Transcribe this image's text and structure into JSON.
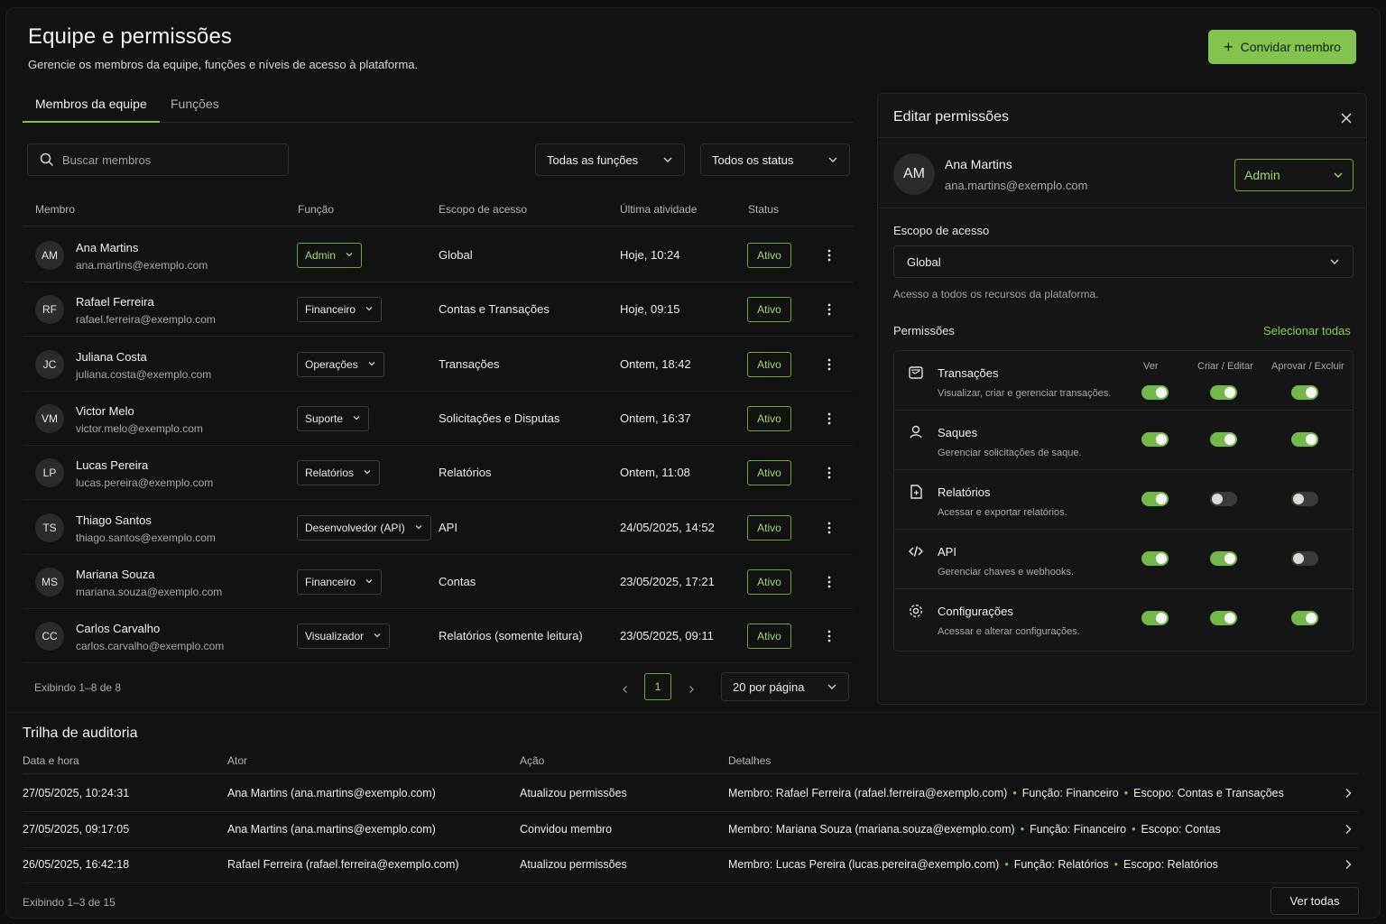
{
  "header": {
    "title": "Equipe e permissões",
    "subtitle": "Gerencie os membros da equipe, funções e níveis de acesso à plataforma.",
    "invite_label": "Convidar membro"
  },
  "tabs": [
    {
      "label": "Membros da equipe",
      "active": true
    },
    {
      "label": "Funções",
      "active": false
    }
  ],
  "filters": {
    "search_placeholder": "Buscar membros",
    "role_filter": "Todas as funções",
    "status_filter": "Todos os status"
  },
  "table": {
    "columns": [
      "Membro",
      "Função",
      "Escopo de acesso",
      "Última atividade",
      "Status"
    ],
    "rows": [
      {
        "initials": "AM",
        "name": "Ana Martins",
        "email": "ana.martins@exemplo.com",
        "role": "Admin",
        "scope": "Global",
        "last": "Hoje, 10:24",
        "status": "Ativo"
      },
      {
        "initials": "RF",
        "name": "Rafael Ferreira",
        "email": "rafael.ferreira@exemplo.com",
        "role": "Financeiro",
        "scope": "Contas e Transações",
        "last": "Hoje, 09:15",
        "status": "Ativo"
      },
      {
        "initials": "JC",
        "name": "Juliana Costa",
        "email": "juliana.costa@exemplo.com",
        "role": "Operações",
        "scope": "Transações",
        "last": "Ontem, 18:42",
        "status": "Ativo"
      },
      {
        "initials": "VM",
        "name": "Victor Melo",
        "email": "victor.melo@exemplo.com",
        "role": "Suporte",
        "scope": "Solicitações e Disputas",
        "last": "Ontem, 16:37",
        "status": "Ativo"
      },
      {
        "initials": "LP",
        "name": "Lucas Pereira",
        "email": "lucas.pereira@exemplo.com",
        "role": "Relatórios",
        "scope": "Relatórios",
        "last": "Ontem, 11:08",
        "status": "Ativo"
      },
      {
        "initials": "TS",
        "name": "Thiago Santos",
        "email": "thiago.santos@exemplo.com",
        "role": "Desenvolvedor (API)",
        "scope": "API",
        "last": "24/05/2025, 14:52",
        "status": "Ativo"
      },
      {
        "initials": "MS",
        "name": "Mariana Souza",
        "email": "mariana.souza@exemplo.com",
        "role": "Financeiro",
        "scope": "Contas",
        "last": "23/05/2025, 17:21",
        "status": "Ativo"
      },
      {
        "initials": "CC",
        "name": "Carlos Carvalho",
        "email": "carlos.carvalho@exemplo.com",
        "role": "Visualizador",
        "scope": "Relatórios (somente leitura)",
        "last": "23/05/2025, 09:11",
        "status": "Ativo"
      }
    ],
    "showing": "Exibindo 1–8 de 8",
    "page": "1",
    "per_page": "20 por página"
  },
  "panel": {
    "title": "Editar permissões",
    "member_initials": "AM",
    "member_name": "Ana Martins",
    "member_email": "ana.martins@exemplo.com",
    "member_role": "Admin",
    "scope_label": "Escopo de acesso",
    "scope_value": "Global",
    "scope_hint": "Acesso a todos os recursos da plataforma.",
    "permissions_label": "Permissões",
    "select_all": "Selecionar todas",
    "columns": [
      "Ver",
      "Criar / Editar",
      "Aprovar / Excluir"
    ],
    "permissions": [
      {
        "name": "Transações",
        "desc": "Visualizar, criar e gerenciar transações.",
        "icon": "transactions-icon",
        "view": true,
        "edit": true,
        "approve": true
      },
      {
        "name": "Saques",
        "desc": "Gerenciar solicitações de saque.",
        "icon": "withdraw-icon",
        "view": true,
        "edit": true,
        "approve": true
      },
      {
        "name": "Relatórios",
        "desc": "Acessar e exportar relatórios.",
        "icon": "report-icon",
        "view": true,
        "edit": false,
        "approve": false
      },
      {
        "name": "API",
        "desc": "Gerenciar chaves e webhooks.",
        "icon": "code-icon",
        "view": true,
        "edit": true,
        "approve": false
      },
      {
        "name": "Configurações",
        "desc": "Acessar e alterar configurações.",
        "icon": "gear-icon",
        "view": true,
        "edit": true,
        "approve": true
      }
    ]
  },
  "audit": {
    "title": "Trilha de auditoria",
    "columns": [
      "Data e hora",
      "Ator",
      "Ação",
      "Detalhes"
    ],
    "rows": [
      {
        "when": "27/05/2025, 10:24:31",
        "actor": "Ana Martins (ana.martins@exemplo.com)",
        "action": "Atualizou permissões",
        "d1": "Membro: Rafael Ferreira (rafael.ferreira@exemplo.com)",
        "d2": "Função: Financeiro",
        "d3": "Escopo: Contas e Transações"
      },
      {
        "when": "27/05/2025, 09:17:05",
        "actor": "Ana Martins (ana.martins@exemplo.com)",
        "action": "Convidou membro",
        "d1": "Membro: Mariana Souza (mariana.souza@exemplo.com)",
        "d2": "Função: Financeiro",
        "d3": "Escopo: Contas"
      },
      {
        "when": "26/05/2025, 16:42:18",
        "actor": "Rafael Ferreira (rafael.ferreira@exemplo.com)",
        "action": "Atualizou permissões",
        "d1": "Membro: Lucas Pereira (lucas.pereira@exemplo.com)",
        "d2": "Função: Relatórios",
        "d3": "Escopo: Relatórios"
      }
    ],
    "showing": "Exibindo 1–3 de 15",
    "view_all": "Ver todas"
  },
  "colors": {
    "accent": "#83c44e",
    "accent_text": "#9fda6d",
    "background": "#111211"
  }
}
